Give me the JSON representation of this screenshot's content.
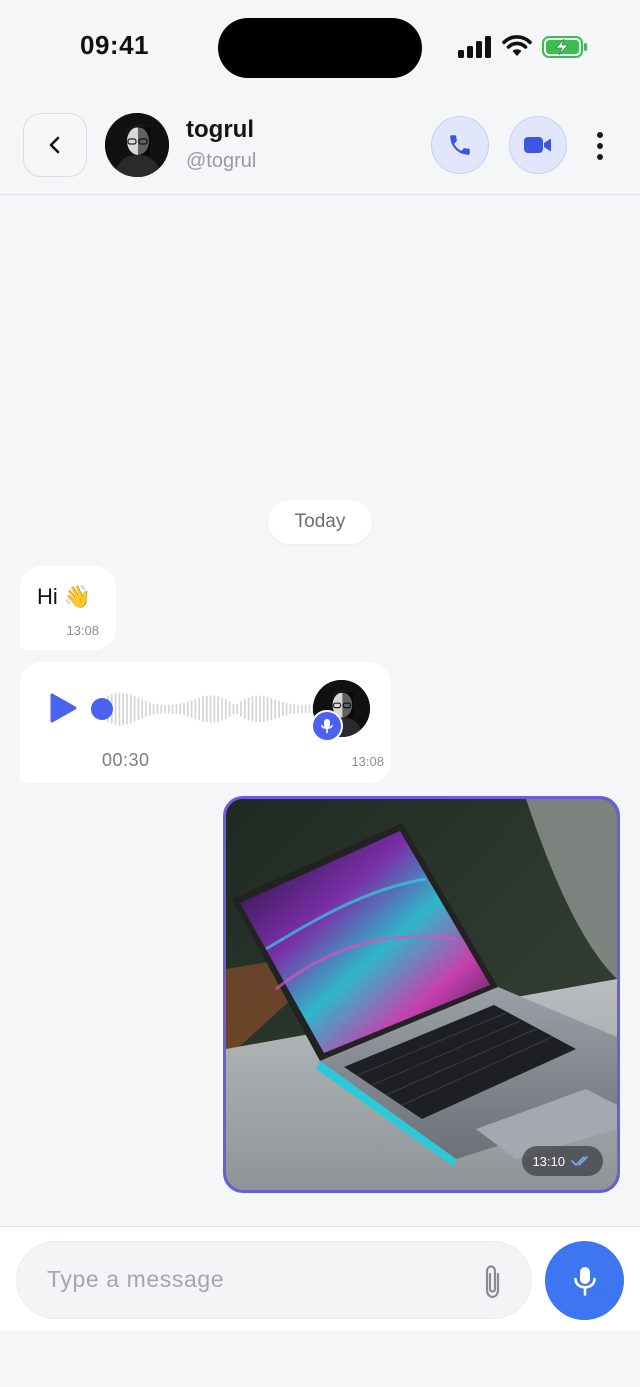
{
  "status_bar": {
    "time": "09:41"
  },
  "header": {
    "back_icon": "chevron-left-icon",
    "name": "togrul",
    "handle": "@togrul",
    "call_icon": "phone-icon",
    "video_icon": "video-camera-icon",
    "more_icon": "more-vertical-icon"
  },
  "chat": {
    "date_separator": "Today",
    "messages": [
      {
        "type": "text",
        "direction": "incoming",
        "text": "Hi 👋",
        "time": "13:08"
      },
      {
        "type": "voice",
        "direction": "incoming",
        "duration": "00:30",
        "time": "13:08",
        "playback_progress": 0
      },
      {
        "type": "image",
        "direction": "outgoing",
        "image_subject": "laptop on a desk",
        "time": "13:10",
        "status_icon": "double-check-icon"
      }
    ]
  },
  "composer": {
    "placeholder": "Type a message",
    "attach_icon": "paperclip-icon",
    "mic_icon": "microphone-icon"
  },
  "colors": {
    "accent": "#4a62ef",
    "mic_button": "#3d76f0",
    "image_border": "#6d5be0",
    "background": "#f5f6f8"
  }
}
